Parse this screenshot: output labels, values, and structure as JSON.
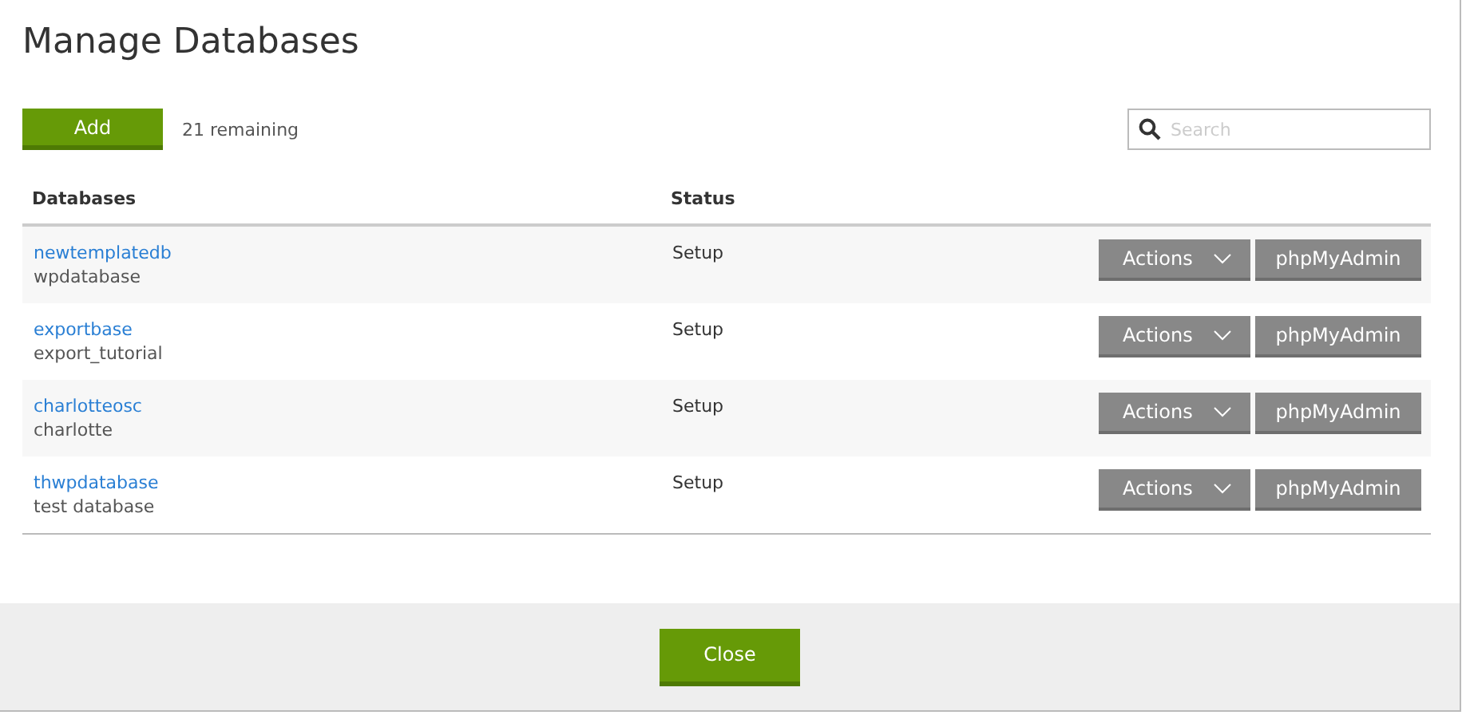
{
  "dialog": {
    "title": "Manage Databases"
  },
  "add_button": "Add",
  "remaining": "21 remaining",
  "search": {
    "placeholder": "Search"
  },
  "table": {
    "columns": [
      "Databases",
      "Status"
    ],
    "rows": [
      {
        "name": "newtemplatedb",
        "user": "wpdatabase",
        "status": "Setup",
        "actions": "Actions",
        "admin": "phpMyAdmin"
      },
      {
        "name": "exportbase",
        "user": "export_tutorial",
        "status": "Setup",
        "actions": "Actions",
        "admin": "phpMyAdmin"
      },
      {
        "name": "charlotteosc",
        "user": "charlotte",
        "status": "Setup",
        "actions": "Actions",
        "admin": "phpMyAdmin"
      },
      {
        "name": "thwpdatabase",
        "user": "test database",
        "status": "Setup",
        "actions": "Actions",
        "admin": "phpMyAdmin"
      }
    ]
  },
  "close_button": "Close"
}
